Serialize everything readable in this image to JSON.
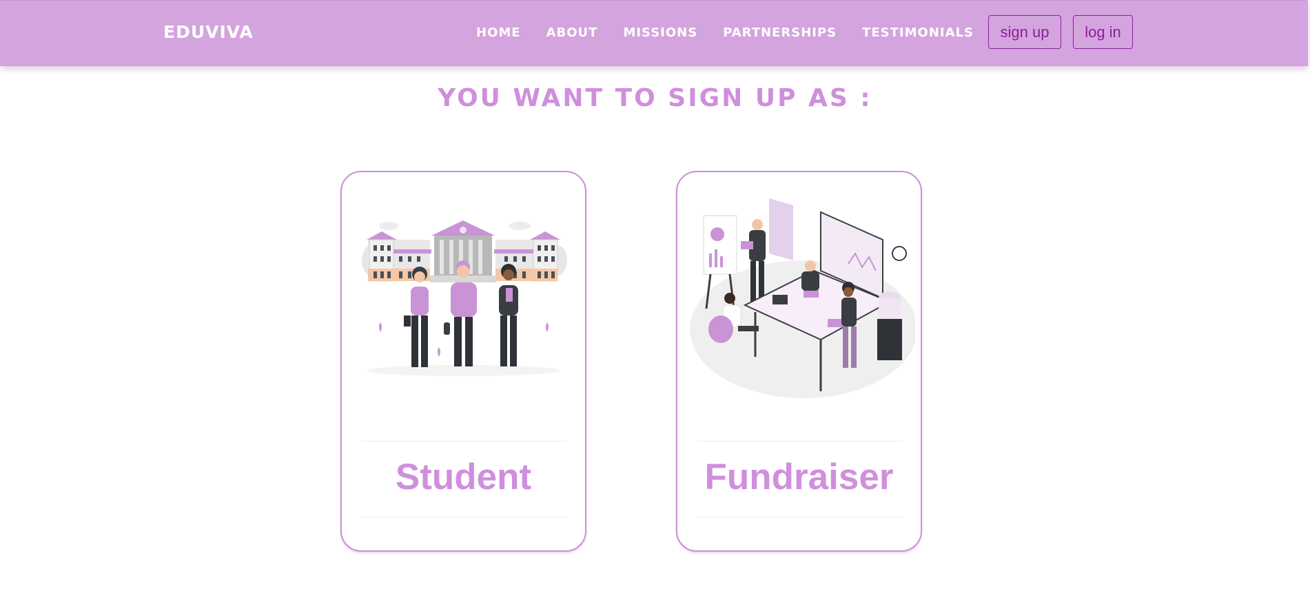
{
  "header": {
    "brand": "EDUVIVA",
    "nav": [
      "HOME",
      "ABOUT",
      "MISSIONS",
      "PARTNERSHIPS",
      "TESTIMONIALS"
    ],
    "signup_label": "sign up",
    "login_label": "log in"
  },
  "main": {
    "title": "YOU WANT TO SIGN UP AS :",
    "cards": [
      {
        "label": "Student",
        "image": "students-in-front-of-university-illustration"
      },
      {
        "label": "Fundraiser",
        "image": "team-meeting-office-illustration"
      }
    ]
  },
  "colors": {
    "navbar": "#d4a4df",
    "accent": "#cf8fdc",
    "button_text": "#8b1e9a",
    "card_border": "#c893d3"
  }
}
